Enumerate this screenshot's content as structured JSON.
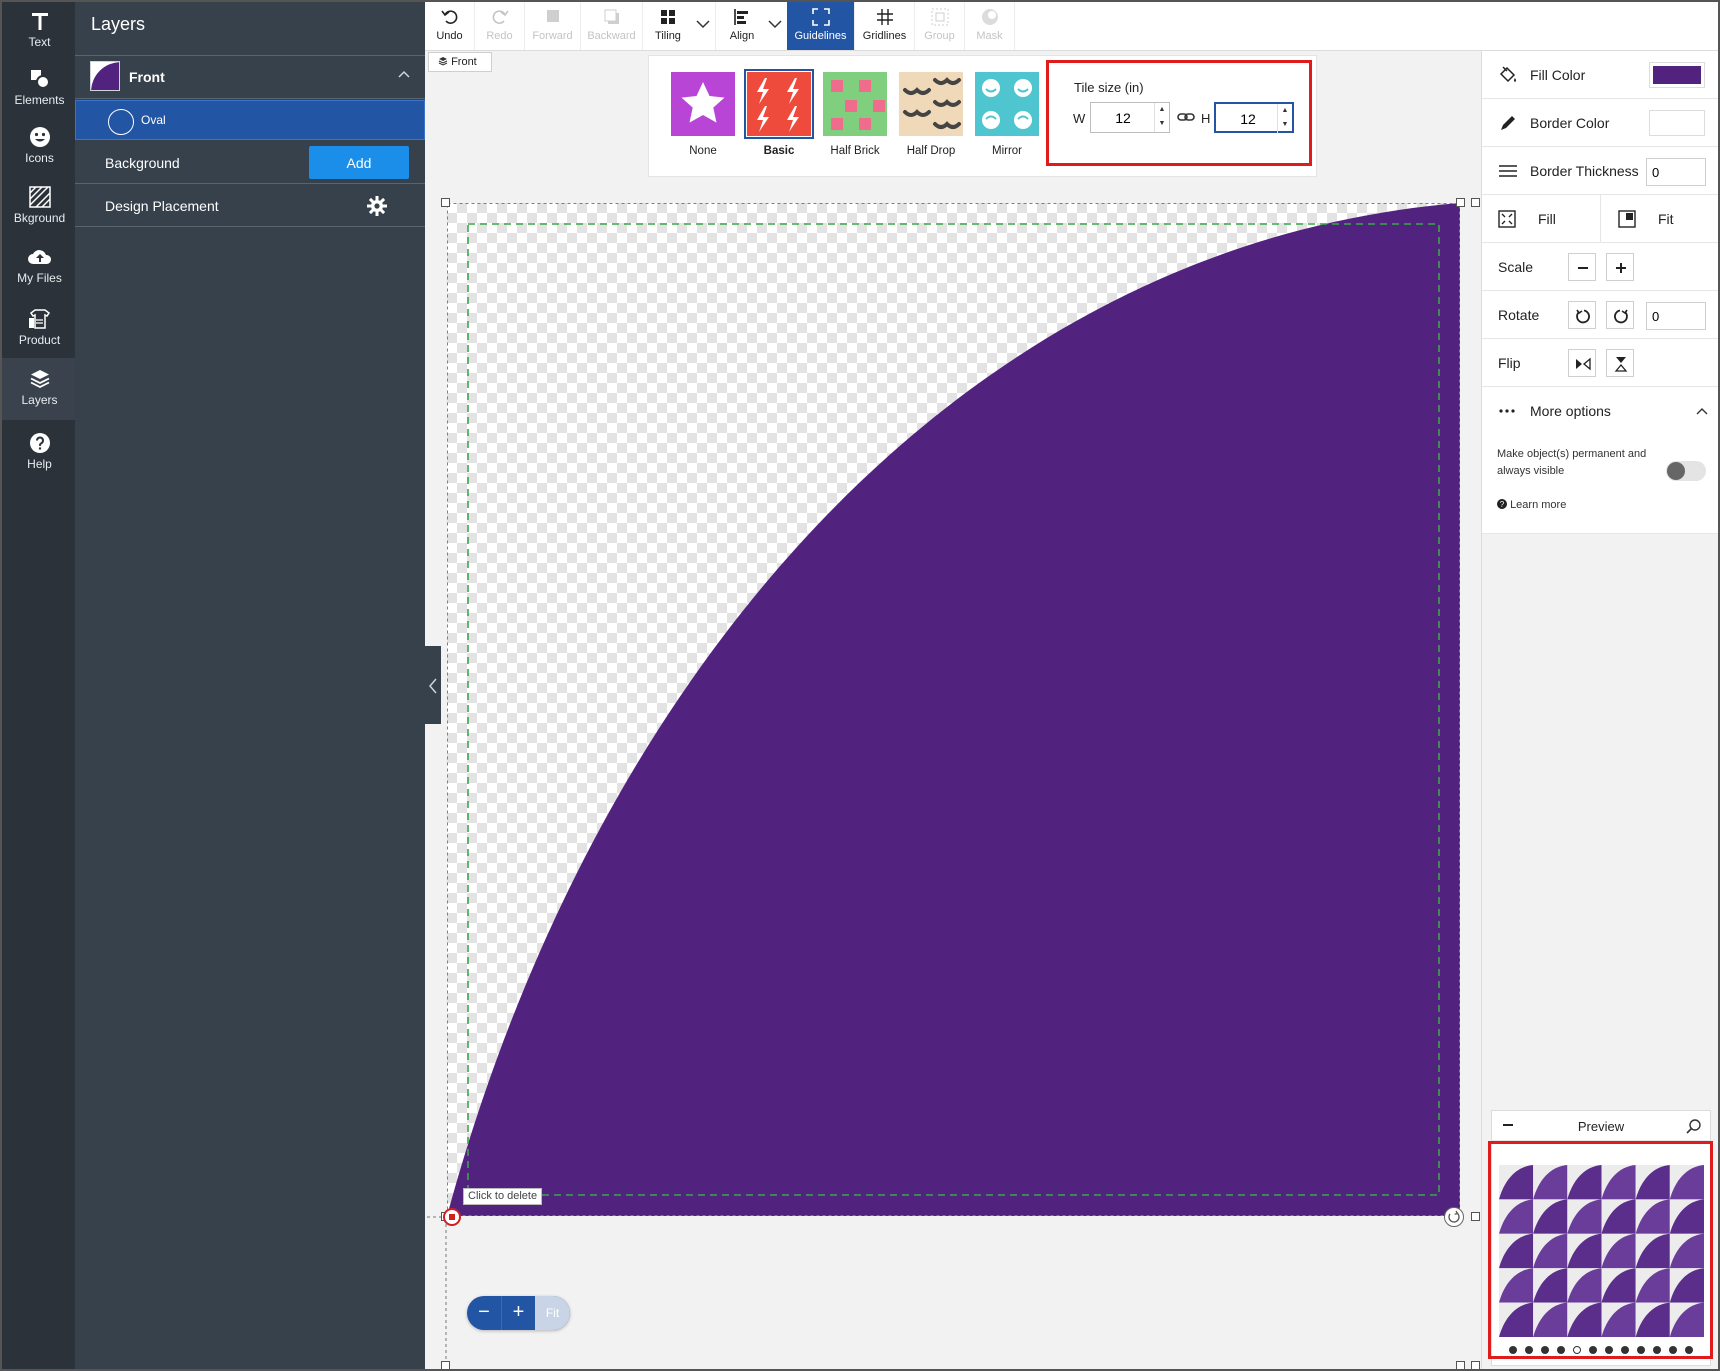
{
  "rail": {
    "items": [
      {
        "label": "Text",
        "icon": "text-icon"
      },
      {
        "label": "Elements",
        "icon": "elements-icon"
      },
      {
        "label": "Icons",
        "icon": "smiley-icon"
      },
      {
        "label": "Bkground",
        "icon": "background-icon"
      },
      {
        "label": "My Files",
        "icon": "cloud-upload-icon"
      },
      {
        "label": "Product",
        "icon": "product-icon"
      },
      {
        "label": "Layers",
        "icon": "layers-icon"
      },
      {
        "label": "Help",
        "icon": "help-icon"
      }
    ],
    "active": "Layers"
  },
  "layers": {
    "title": "Layers",
    "front_label": "Front",
    "oval_label": "Oval",
    "background_label": "Background",
    "add_label": "Add",
    "design_placement_label": "Design Placement"
  },
  "toolbar": {
    "undo": "Undo",
    "redo": "Redo",
    "forward": "Forward",
    "backward": "Backward",
    "tiling": "Tiling",
    "align": "Align",
    "guidelines": "Guidelines",
    "gridlines": "Gridlines",
    "group": "Group",
    "mask": "Mask"
  },
  "front_tag": "Front",
  "tiling": {
    "options": [
      {
        "label": "None",
        "color": "#b845d6"
      },
      {
        "label": "Basic",
        "color": "#ef4b3c"
      },
      {
        "label": "Half Brick",
        "color": "#7fcf7f"
      },
      {
        "label": "Half Drop",
        "color": "#f0d9b8"
      },
      {
        "label": "Mirror",
        "color": "#4fc5cf"
      }
    ],
    "selected": "Basic",
    "tile_size_title": "Tile size (in)",
    "w_label": "W",
    "h_label": "H",
    "w_value": "12",
    "h_value": "12"
  },
  "canvas": {
    "shape_color": "#51237f",
    "guide_color": "#3aa64a",
    "click_to_delete": "Click to delete"
  },
  "zoom": {
    "minus": "−",
    "plus": "+",
    "fit": "Fit"
  },
  "props": {
    "fill_color_label": "Fill Color",
    "fill_color": "#51237f",
    "border_color_label": "Border Color",
    "border_color": "#ffffff",
    "border_thickness_label": "Border Thickness",
    "border_thickness_value": "0",
    "fill_label": "Fill",
    "fit_label": "Fit",
    "scale_label": "Scale",
    "rotate_label": "Rotate",
    "rotate_value": "0",
    "flip_label": "Flip",
    "more_options_label": "More options",
    "permanent_label": "Make object(s) permanent and always visible",
    "learn_more": "Learn more"
  },
  "preview": {
    "title": "Preview",
    "tile_color": "#6a3d9a",
    "tile_color_alt": "#5a2e8a",
    "dot_count": 12,
    "current_dot": 4
  }
}
